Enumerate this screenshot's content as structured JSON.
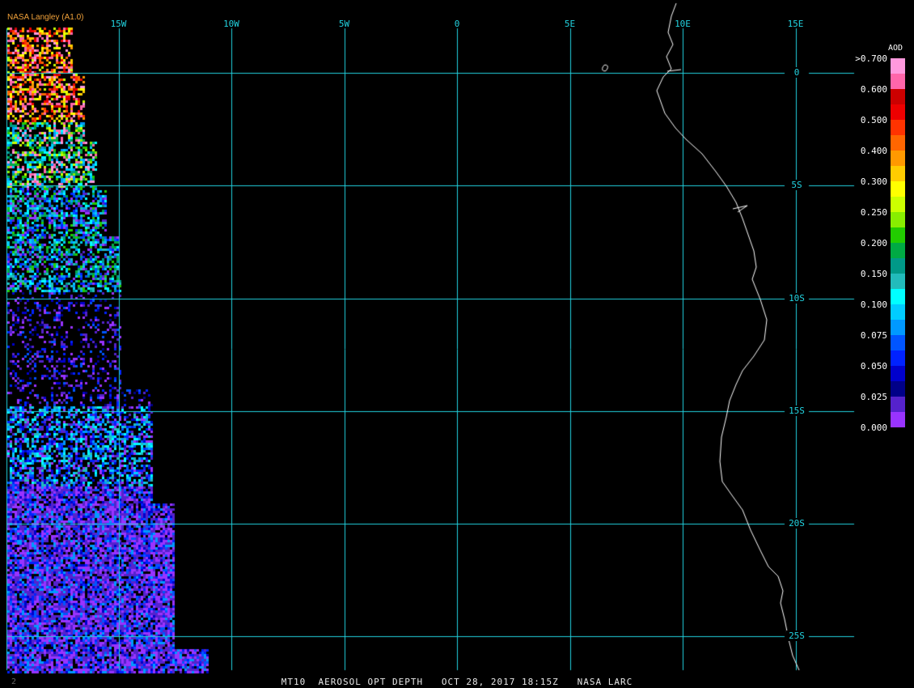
{
  "credit": "NASA Langley (A1.0)",
  "footer": "MT10  AEROSOL OPT DEPTH   OCT 28, 2017 18:15Z   NASA LARC",
  "corner_mark": "2",
  "grid_color": "#22d3e0",
  "coast_color": "#ffffff",
  "longitudes": [
    {
      "label": "15W",
      "lon": -15
    },
    {
      "label": "10W",
      "lon": -10
    },
    {
      "label": "5W",
      "lon": -5
    },
    {
      "label": "0",
      "lon": 0
    },
    {
      "label": "5E",
      "lon": 5
    },
    {
      "label": "10E",
      "lon": 10
    },
    {
      "label": "15E",
      "lon": 15
    }
  ],
  "latitudes": [
    {
      "label": "0",
      "lat": 0
    },
    {
      "label": "5S",
      "lat": -5
    },
    {
      "label": "10S",
      "lat": -10
    },
    {
      "label": "15S",
      "lat": -15
    },
    {
      "label": "20S",
      "lat": -20
    },
    {
      "label": "25S",
      "lat": -25
    }
  ],
  "colorbar": {
    "title": "AOD",
    "labels": [
      ">0.700",
      "0.600",
      "0.500",
      "0.400",
      "0.300",
      "0.250",
      "0.200",
      "0.150",
      "0.100",
      "0.075",
      "0.050",
      "0.025",
      "0.000"
    ],
    "colors": [
      "#ff99dd",
      "#ff66aa",
      "#cc0000",
      "#ee0000",
      "#ff3300",
      "#ff6600",
      "#ff9900",
      "#ffcc00",
      "#ffff00",
      "#ccff00",
      "#88ee00",
      "#22cc00",
      "#00aa44",
      "#009988",
      "#22bbbb",
      "#00ffff",
      "#00ccff",
      "#0099ff",
      "#0055ff",
      "#0022ff",
      "#0000cc",
      "#000088",
      "#5522cc",
      "#9933ff"
    ]
  }
}
